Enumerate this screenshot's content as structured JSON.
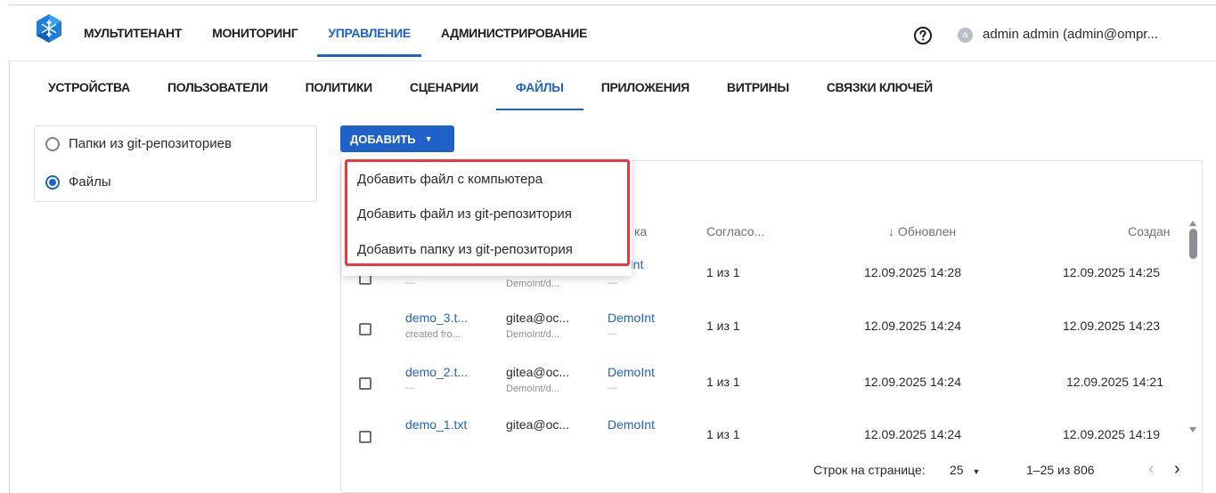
{
  "topnav": {
    "items": [
      "МУЛЬТИТЕНАНТ",
      "МОНИТОРИНГ",
      "УПРАВЛЕНИЕ",
      "АДМИНИСТРИРОВАНИЕ"
    ],
    "active": "УПРАВЛЕНИЕ"
  },
  "user": {
    "avatar_letter": "a",
    "name": "admin admin (admin@ompr..."
  },
  "subnav": {
    "items": [
      "УСТРОЙСТВА",
      "ПОЛЬЗОВАТЕЛИ",
      "ПОЛИТИКИ",
      "СЦЕНАРИИ",
      "ФАЙЛЫ",
      "ПРИЛОЖЕНИЯ",
      "ВИТРИНЫ",
      "СВЯЗКИ КЛЮЧЕЙ"
    ],
    "active": "ФАЙЛЫ"
  },
  "filter": {
    "options": [
      "Папки из git-репозиториев",
      "Файлы"
    ],
    "selected": "Файлы"
  },
  "add_button": {
    "label": "ДОБАВИТЬ"
  },
  "add_menu": {
    "items": [
      "Добавить файл с компьютера",
      "Добавить файл из git-репозитория",
      "Добавить папку из git-репозитория"
    ]
  },
  "table": {
    "headers": {
      "tenant_partial": "ка",
      "agreed": "Согласо...",
      "updated": "Обновлен",
      "created": "Создан"
    },
    "rows": [
      {
        "name": "",
        "name_sub": "—",
        "source": "",
        "source_sub": "DemoInt/d...",
        "tenant": "oInt",
        "tenant_sub": "—",
        "agreed": "1 из 1",
        "updated": "12.09.2025 14:28",
        "created": "12.09.2025 14:25"
      },
      {
        "name": "demo_3.t...",
        "name_sub": "created fro...",
        "source": "gitea@oc...",
        "source_sub": "DemoInt/d...",
        "tenant": "DemoInt",
        "tenant_sub": "—",
        "agreed": "1 из 1",
        "updated": "12.09.2025 14:24",
        "created": "12.09.2025 14:23"
      },
      {
        "name": "demo_2.t...",
        "name_sub": "—",
        "source": "gitea@oc...",
        "source_sub": "DemoInt/d...",
        "tenant": "DemoInt",
        "tenant_sub": "—",
        "agreed": "1 из 1",
        "updated": "12.09.2025 14:24",
        "created": "12.09.2025 14:21"
      },
      {
        "name": "demo_1.txt",
        "name_sub": "",
        "source": "gitea@oc...",
        "source_sub": "",
        "tenant": "DemoInt",
        "tenant_sub": "",
        "agreed": "1 из 1",
        "updated": "12.09.2025 14:24",
        "created": "12.09.2025 14:19"
      }
    ]
  },
  "pagination": {
    "rows_per_page_label": "Строк на странице:",
    "rows_per_page": "25",
    "range": "1–25 из 806"
  },
  "colors": {
    "accent": "#1e62c8",
    "highlight": "#e8373f"
  },
  "icons": {
    "logo": "snowflake-hexagon-logo",
    "help": "question-circle-icon",
    "sort": "arrow-down-icon",
    "caret": "caret-down-icon",
    "prev": "chevron-left-icon",
    "next": "chevron-right-icon"
  }
}
